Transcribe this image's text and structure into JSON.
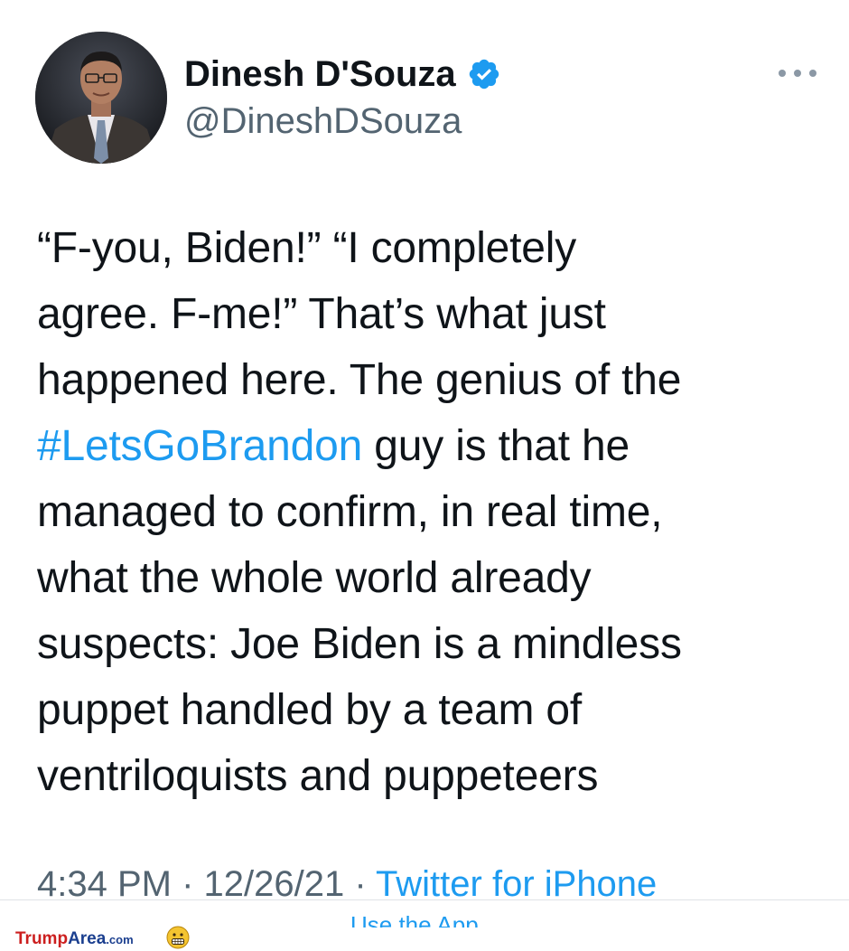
{
  "tweet": {
    "author": {
      "display_name": "Dinesh D'Souza",
      "handle": "@DineshDSouza",
      "verified": true
    },
    "text_lines": [
      "“F-you, Biden!” “I completely",
      "agree. F-me!” That’s what just",
      "happened here. The genius of the",
      " guy is that he",
      "managed to confirm, in real time,",
      "what the whole world already",
      "suspects: Joe Biden is a mindless",
      "puppet handled by a team of",
      "ventriloquists and puppeteers"
    ],
    "hashtag": "#LetsGoBrandon",
    "timestamp": "4:34 PM · 12/26/21 · ",
    "source": "Twitter for iPhone",
    "icons": {
      "more": "more-horizontal-icon",
      "verified": "verified-badge-icon"
    },
    "colors": {
      "link": "#1d9bf0",
      "text": "#0f1419",
      "muted": "#536471"
    }
  },
  "footer": {
    "use_app_label": "Use the App",
    "watermark": {
      "part1": "Trump",
      "part2": "Area",
      "part3": ".com"
    }
  }
}
